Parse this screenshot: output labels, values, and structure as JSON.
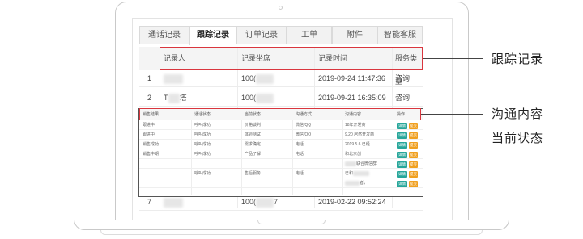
{
  "tabs": [
    "通话记录",
    "跟踪记录",
    "订单记录",
    "工单",
    "附件",
    "智能客服"
  ],
  "active_tab": "跟踪记录",
  "table": {
    "headers": [
      "记录人",
      "记录坐席",
      "记录时间",
      "服务类型"
    ],
    "rows": [
      {
        "num": "1",
        "agent": "100(",
        "time": "2019-09-24 11:47:36",
        "type": "咨询"
      },
      {
        "num": "2",
        "recorder_suffix": "T",
        "recorder_tail": "塔",
        "agent": "100(",
        "time": "2019-09-21 16:35:09",
        "type": "咨询"
      },
      {
        "num": "7",
        "agent": "100(",
        "agent_tail": "7",
        "time": "2019-02-22 09:52:24",
        "type": ""
      }
    ]
  },
  "overlay": {
    "headers": [
      "销售结果",
      "通话状态",
      "当前状态",
      "沟通方式",
      "沟通内容",
      "操作"
    ],
    "rows": [
      {
        "result": "跟进中",
        "call": "呼叫成功",
        "status": "价格谈判",
        "method": "微信/QQ",
        "content": "18年开发商",
        "ops": true
      },
      {
        "result": "跟进中",
        "call": "呼叫成功",
        "status": "体验测试",
        "method": "微信/QQ",
        "content": "9.20 居然开发商",
        "ops": true
      },
      {
        "result": "销售成功",
        "call": "呼叫成功",
        "status": "需求确定",
        "method": "电话",
        "content": "2019.5.6 已经",
        "ops": true
      },
      {
        "result": "销售中期",
        "call": "呼叫成功",
        "status": "产品了解",
        "method": "电话",
        "content": "和北京创",
        "ops": true
      },
      {
        "result": "",
        "call": "",
        "status": "",
        "method": "",
        "content": "联合微信群",
        "ops": true
      },
      {
        "result": "",
        "call": "呼叫成功",
        "status": "售后服务",
        "method": "电话",
        "content": "已和",
        "ops": true
      },
      {
        "result": "",
        "call": "",
        "status": "",
        "method": "",
        "content": "者，",
        "ops": true
      }
    ],
    "btn_detail": "详情",
    "btn_order": "提交"
  },
  "callouts": {
    "track_record": "跟踪记录",
    "communication_content": "沟通内容",
    "current_status": "当前状态"
  },
  "colors": {
    "highlight": "#d9363e",
    "detail_button": "#26a69a",
    "order_button": "#f0a020"
  }
}
